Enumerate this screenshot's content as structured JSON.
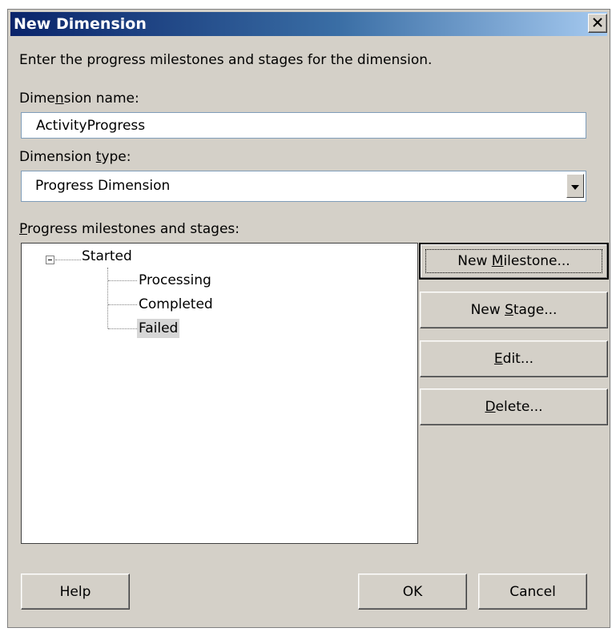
{
  "dialog": {
    "title": "New Dimension",
    "close_glyph": "✕",
    "instructions": "Enter the progress milestones and stages for the dimension."
  },
  "dimension_name": {
    "label_pre": "Dime",
    "label_hot": "n",
    "label_post": "sion name:",
    "value": "ActivityProgress"
  },
  "dimension_type": {
    "label_pre": "Dimension ",
    "label_hot": "t",
    "label_post": "ype:",
    "selected": "Progress Dimension"
  },
  "tree": {
    "label_pre": "",
    "label_hot": "P",
    "label_post": "rogress milestones and stages:",
    "root": "Started",
    "children": [
      "Processing",
      "Completed",
      "Failed"
    ],
    "selected": "Failed"
  },
  "side_buttons": {
    "new_milestone": {
      "pre": "New ",
      "hot": "M",
      "post": "ilestone..."
    },
    "new_stage": {
      "pre": "New ",
      "hot": "S",
      "post": "tage..."
    },
    "edit": {
      "pre": "",
      "hot": "E",
      "post": "dit..."
    },
    "delete": {
      "pre": "",
      "hot": "D",
      "post": "elete..."
    }
  },
  "footer": {
    "help": "Help",
    "ok": "OK",
    "cancel": "Cancel"
  }
}
